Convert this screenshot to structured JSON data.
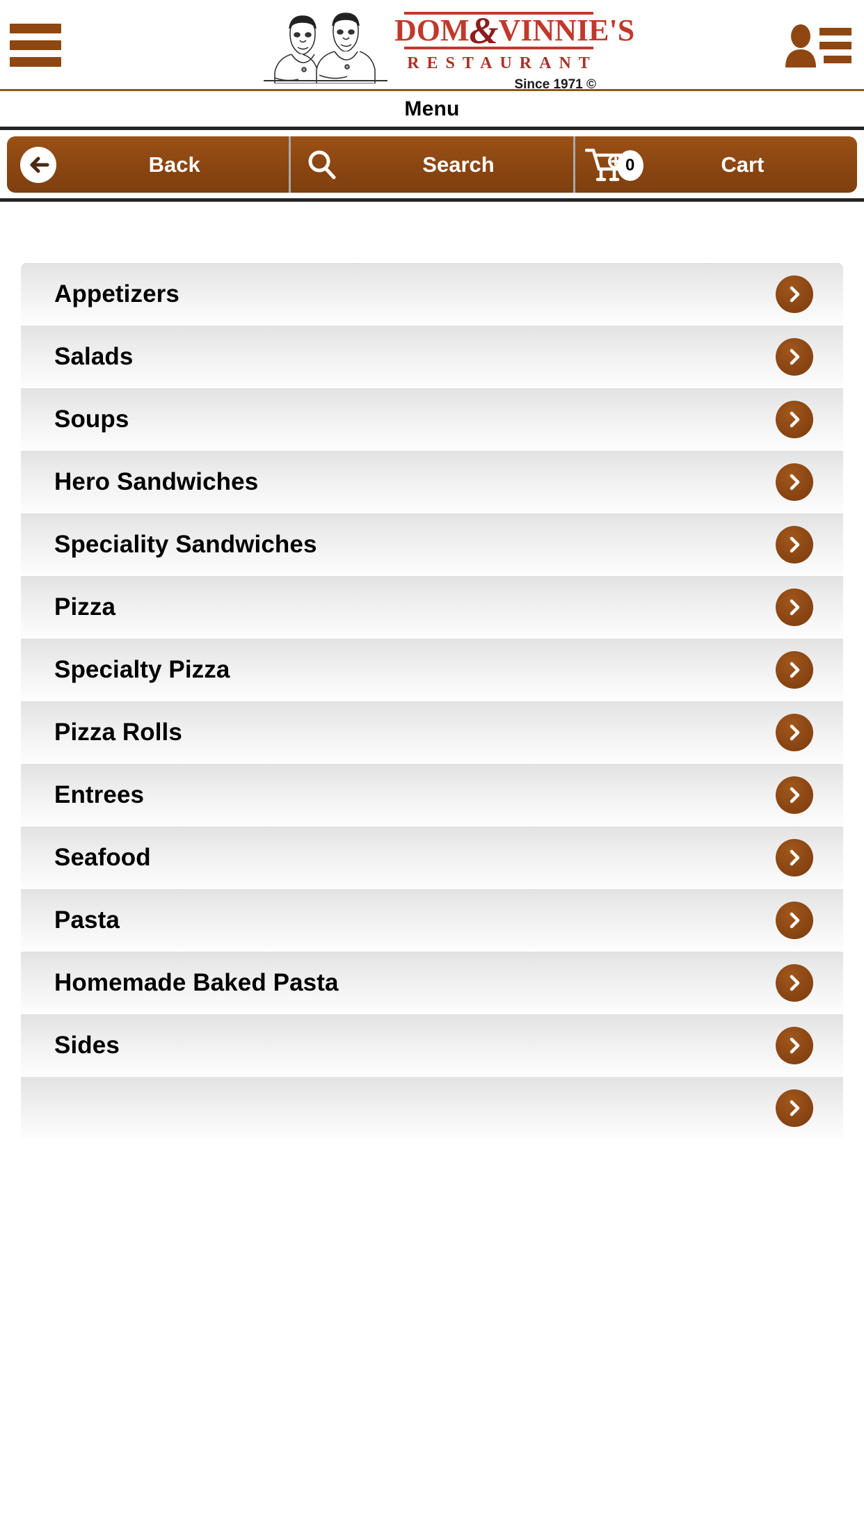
{
  "header": {
    "menu_icon": "hamburger-icon",
    "account_icon": "account-menu-icon",
    "logo": {
      "name_line": "DOM",
      "ampersand": "&",
      "name_line2": "VINNIE'S",
      "subtitle": "RESTAURANT",
      "since": "Since 1971 ©",
      "brand_red": "#c0392b",
      "brand_brown": "#8a4513"
    }
  },
  "page": {
    "title": "Menu"
  },
  "toolbar": {
    "back_label": "Back",
    "search_label": "Search",
    "cart_label": "Cart",
    "cart_count": "0",
    "back_icon": "arrow-left-circle-icon",
    "search_icon": "search-icon",
    "cart_icon": "shopping-cart-add-icon",
    "bar_color": "#8a4513"
  },
  "menu": {
    "arrow_icon": "chevron-right-circle-icon",
    "categories": [
      {
        "label": "Appetizers"
      },
      {
        "label": "Salads"
      },
      {
        "label": "Soups"
      },
      {
        "label": "Hero Sandwiches"
      },
      {
        "label": "Speciality Sandwiches"
      },
      {
        "label": "Pizza"
      },
      {
        "label": "Specialty Pizza"
      },
      {
        "label": "Pizza Rolls"
      },
      {
        "label": "Entrees"
      },
      {
        "label": "Seafood"
      },
      {
        "label": "Pasta"
      },
      {
        "label": "Homemade Baked Pasta"
      },
      {
        "label": "Sides"
      },
      {
        "label": ""
      }
    ]
  }
}
